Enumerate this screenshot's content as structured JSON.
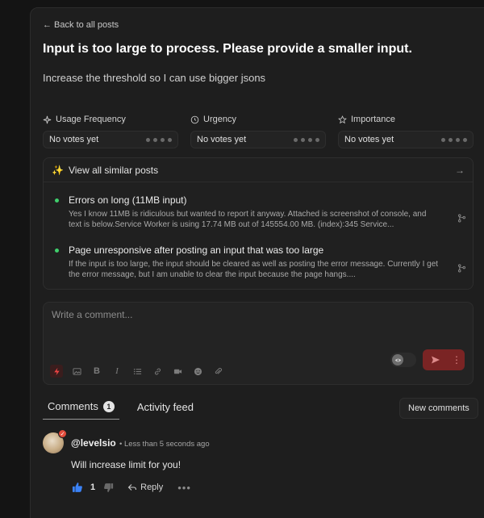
{
  "back_link": "← Back to all posts",
  "post": {
    "title": "Input is too large to process. Please provide a smaller input.",
    "description": "Increase the threshold so I can use bigger jsons"
  },
  "votes": [
    {
      "label": "Usage Frequency",
      "icon": "sparkle-icon",
      "value": "No votes yet"
    },
    {
      "label": "Urgency",
      "icon": "clock-icon",
      "value": "No votes yet"
    },
    {
      "label": "Importance",
      "icon": "star-icon",
      "value": "No votes yet"
    }
  ],
  "similar": {
    "header": "View all similar posts",
    "items": [
      {
        "title": "Errors on long (11MB input)",
        "body": "Yes I know 11MB is ridiculous but wanted to report it anyway. Attached is screenshot of console, and text is below.Service Worker is using 17.74 MB out of 145554.00 MB. (index):345 Service..."
      },
      {
        "title": "Page unresponsive after posting an input that was too large",
        "body": "If the input is too large, the input should be cleared as well as posting the error message. Currently I get the error message, but I am unable to clear the input because the page hangs...."
      }
    ]
  },
  "comment_box": {
    "placeholder": "Write a comment..."
  },
  "tabs": {
    "comments_label": "Comments",
    "comments_count": "1",
    "activity_label": "Activity feed"
  },
  "new_comments_button": "New comments",
  "comments": [
    {
      "user": "@levelsio",
      "time": "Less than 5 seconds ago",
      "text": "Will increase limit for you!",
      "likes": "1",
      "reply_label": "Reply"
    }
  ],
  "colors": {
    "accent_red": "#ef4444",
    "status_green": "#3fcf6c",
    "like_blue": "#3b82f6"
  }
}
